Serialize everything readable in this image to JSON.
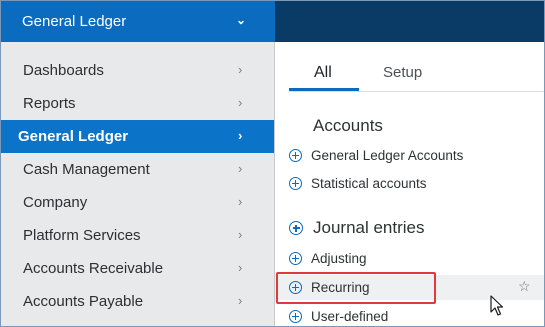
{
  "header": {
    "app_switcher_label": "General Ledger",
    "app_switcher_icon": "chevron-down-icon"
  },
  "sidebar": {
    "items": [
      {
        "label": "Dashboards"
      },
      {
        "label": "Reports"
      },
      {
        "label": "General Ledger",
        "active": true
      },
      {
        "label": "Cash Management"
      },
      {
        "label": "Company"
      },
      {
        "label": "Platform Services"
      },
      {
        "label": "Accounts Receivable"
      },
      {
        "label": "Accounts Payable"
      }
    ],
    "arrow_glyph": "›"
  },
  "tabs": [
    {
      "label": "All",
      "active": true
    },
    {
      "label": "Setup"
    }
  ],
  "sections": {
    "accounts": {
      "title": "Accounts",
      "links": [
        "General Ledger Accounts",
        "Statistical accounts"
      ]
    },
    "journal_entries": {
      "title": "Journal entries",
      "links": [
        "Adjusting",
        "Recurring",
        "User-defined"
      ]
    }
  },
  "glyphs": {
    "chevron_down": "⌄",
    "star": "☆"
  },
  "colors": {
    "brand_blue": "#0b6bbf",
    "header_dark": "#0a3a66",
    "sidebar_bg": "#e8e9ea",
    "active_item": "#0b73c8",
    "highlight_red": "#e0393e"
  }
}
